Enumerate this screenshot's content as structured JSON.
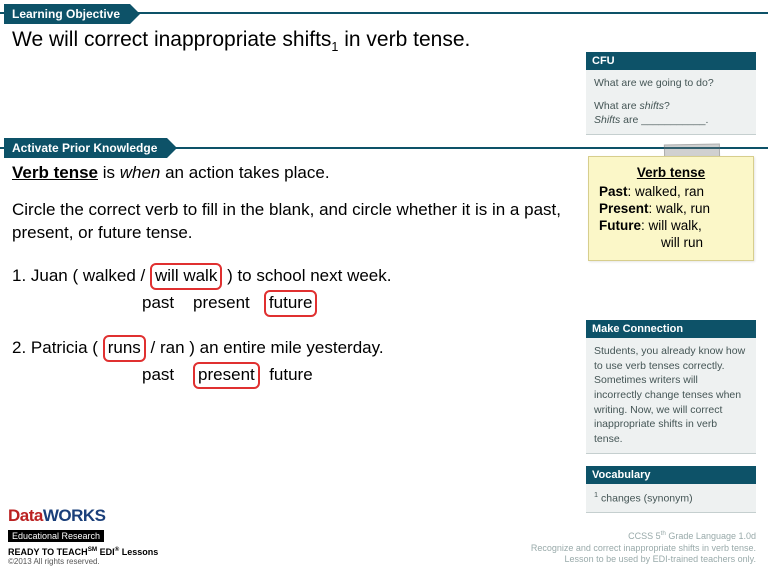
{
  "ribbons": {
    "learning_objective": "Learning Objective",
    "activate_prior": "Activate Prior Knowledge"
  },
  "lo_text_pre": "We will correct inappropriate shifts",
  "lo_sub": "1",
  "lo_text_post": " in verb tense.",
  "main": {
    "def_bold": "Verb tense",
    "def_mid": " is ",
    "def_italic": "when",
    "def_end": " an action takes place.",
    "instruction": "Circle the correct verb to fill in the blank, and circle whether it is in a past, present, or future tense."
  },
  "ex1": {
    "pre": "1. Juan ( walked /",
    "box": "will walk",
    "post": ") to school next week.",
    "t_past": "past",
    "t_present": "present",
    "t_future": "future"
  },
  "ex2": {
    "pre": "2. Patricia (",
    "box": "runs",
    "mid": "/ ran ) an entire mile yesterday.",
    "t_past": "past",
    "t_present": "present",
    "t_future": "future"
  },
  "cfu": {
    "head": "CFU",
    "q1": "What are we going to do?",
    "q2_pre": "What are ",
    "q2_i": "shifts",
    "q2_post": "?",
    "q3_i": "Shifts",
    "q3_post": " are ___________."
  },
  "sticky": {
    "title": "Verb tense",
    "past_label": "Past",
    "past_val": ": walked, ran",
    "present_label": "Present",
    "present_val": ": walk, run",
    "future_label": "Future",
    "future_val": ": will walk,",
    "future_val2": "will run"
  },
  "mc": {
    "head": "Make Connection",
    "body": "Students, you already know how to use verb tenses correctly. Sometimes writers will incorrectly change tenses when writing. Now, we will correct inappropriate shifts in verb tense."
  },
  "vocab": {
    "head": "Vocabulary",
    "sup": "1",
    "body": " changes (synonym)"
  },
  "footer": {
    "logo_data": "Data",
    "logo_works": "WORKS",
    "logo_sub": "Educational Research",
    "tag_pre": "READY TO TEACH",
    "tag_sm": "SM",
    "tag_mid": " EDI",
    "tag_reg": "®",
    "tag_post": " Lessons",
    "copy": "©2013 All rights reserved.",
    "r1_pre": "CCSS 5",
    "r1_sup": "th",
    "r1_post": " Grade Language 1.0d",
    "r2": "Recognize and correct inappropriate shifts in verb tense.",
    "r3": "Lesson to be used by EDI-trained teachers only."
  }
}
